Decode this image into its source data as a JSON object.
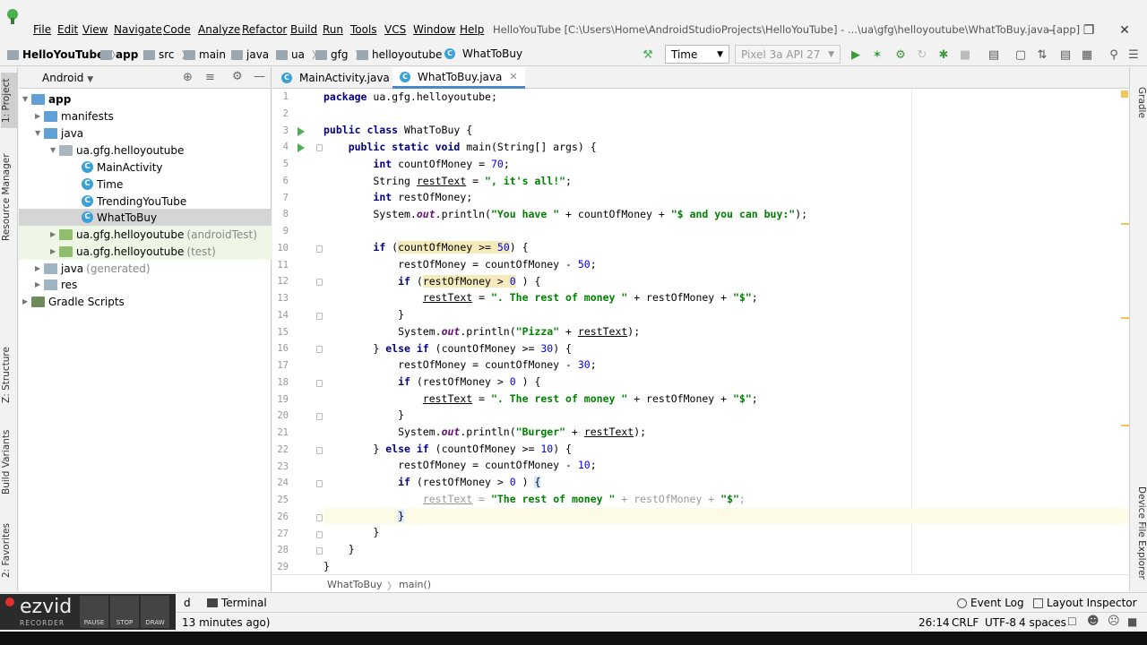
{
  "menu": {
    "items": [
      "File",
      "Edit",
      "View",
      "Navigate",
      "Code",
      "Analyze",
      "Refactor",
      "Build",
      "Run",
      "Tools",
      "VCS",
      "Window",
      "Help"
    ],
    "window_title": "HelloYouTube [C:\\Users\\Home\\AndroidStudioProjects\\HelloYouTube] - ...\\ua\\gfg\\helloyoutube\\WhatToBuy.java [app]"
  },
  "navbar": {
    "breadcrumbs": [
      "HelloYouTube",
      "app",
      "src",
      "main",
      "java",
      "ua",
      "gfg",
      "helloyoutube",
      "WhatToBuy"
    ],
    "run_config": "Time",
    "device": "Pixel 3a API 27"
  },
  "left_tabs": [
    "1: Project",
    "Resource Manager",
    "Z: Structure",
    "Build Variants",
    "2: Favorites"
  ],
  "right_tabs": [
    "Gradle",
    "Device File Explorer"
  ],
  "project": {
    "view": "Android",
    "tree": [
      {
        "label": "app",
        "icon": "folder-icon"
      },
      {
        "label": "manifests",
        "icon": "folder-icon"
      },
      {
        "label": "java",
        "icon": "folder-icon"
      },
      {
        "label": "ua.gfg.helloyoutube",
        "icon": "package-icon"
      },
      {
        "label": "MainActivity",
        "icon": "class-icon"
      },
      {
        "label": "Time",
        "icon": "class-icon"
      },
      {
        "label": "TrendingYouTube",
        "icon": "class-icon"
      },
      {
        "label": "WhatToBuy",
        "icon": "class-icon"
      },
      {
        "label": "ua.gfg.helloyoutube",
        "suffix": "(androidTest)",
        "icon": "package-icon"
      },
      {
        "label": "ua.gfg.helloyoutube",
        "suffix": "(test)",
        "icon": "package-icon"
      },
      {
        "label": "java",
        "suffix": "(generated)",
        "icon": "folder-icon"
      },
      {
        "label": "res",
        "icon": "folder-icon"
      },
      {
        "label": "Gradle Scripts",
        "icon": "gradle-icon"
      }
    ]
  },
  "editor": {
    "tabs": [
      "MainActivity.java",
      "WhatToBuy.java"
    ],
    "line_numbers": [
      "1",
      "2",
      "3",
      "4",
      "5",
      "6",
      "7",
      "8",
      "9",
      "10",
      "11",
      "12",
      "13",
      "14",
      "15",
      "16",
      "17",
      "18",
      "19",
      "20",
      "21",
      "22",
      "23",
      "24",
      "25",
      "26",
      "27",
      "28",
      "29"
    ],
    "breadcrumb": [
      "WhatToBuy",
      "main()"
    ]
  },
  "bottom": {
    "tools": [
      "Terminal",
      "Event Log",
      "Layout Inspector"
    ],
    "status_message": "13 minutes ago)",
    "cursor": "26:14",
    "line_sep": "CRLF",
    "encoding": "UTF-8",
    "indent": "4 spaces"
  },
  "ezvid": {
    "logo": "ezvid",
    "sub": "RECORDER",
    "buttons": [
      "PAUSE",
      "STOP",
      "DRAW"
    ]
  },
  "colors": {
    "keyword": "#000080",
    "string": "#008000",
    "number": "#0000ff",
    "selection": "#d5d5d5",
    "accent": "#4a88c7"
  }
}
